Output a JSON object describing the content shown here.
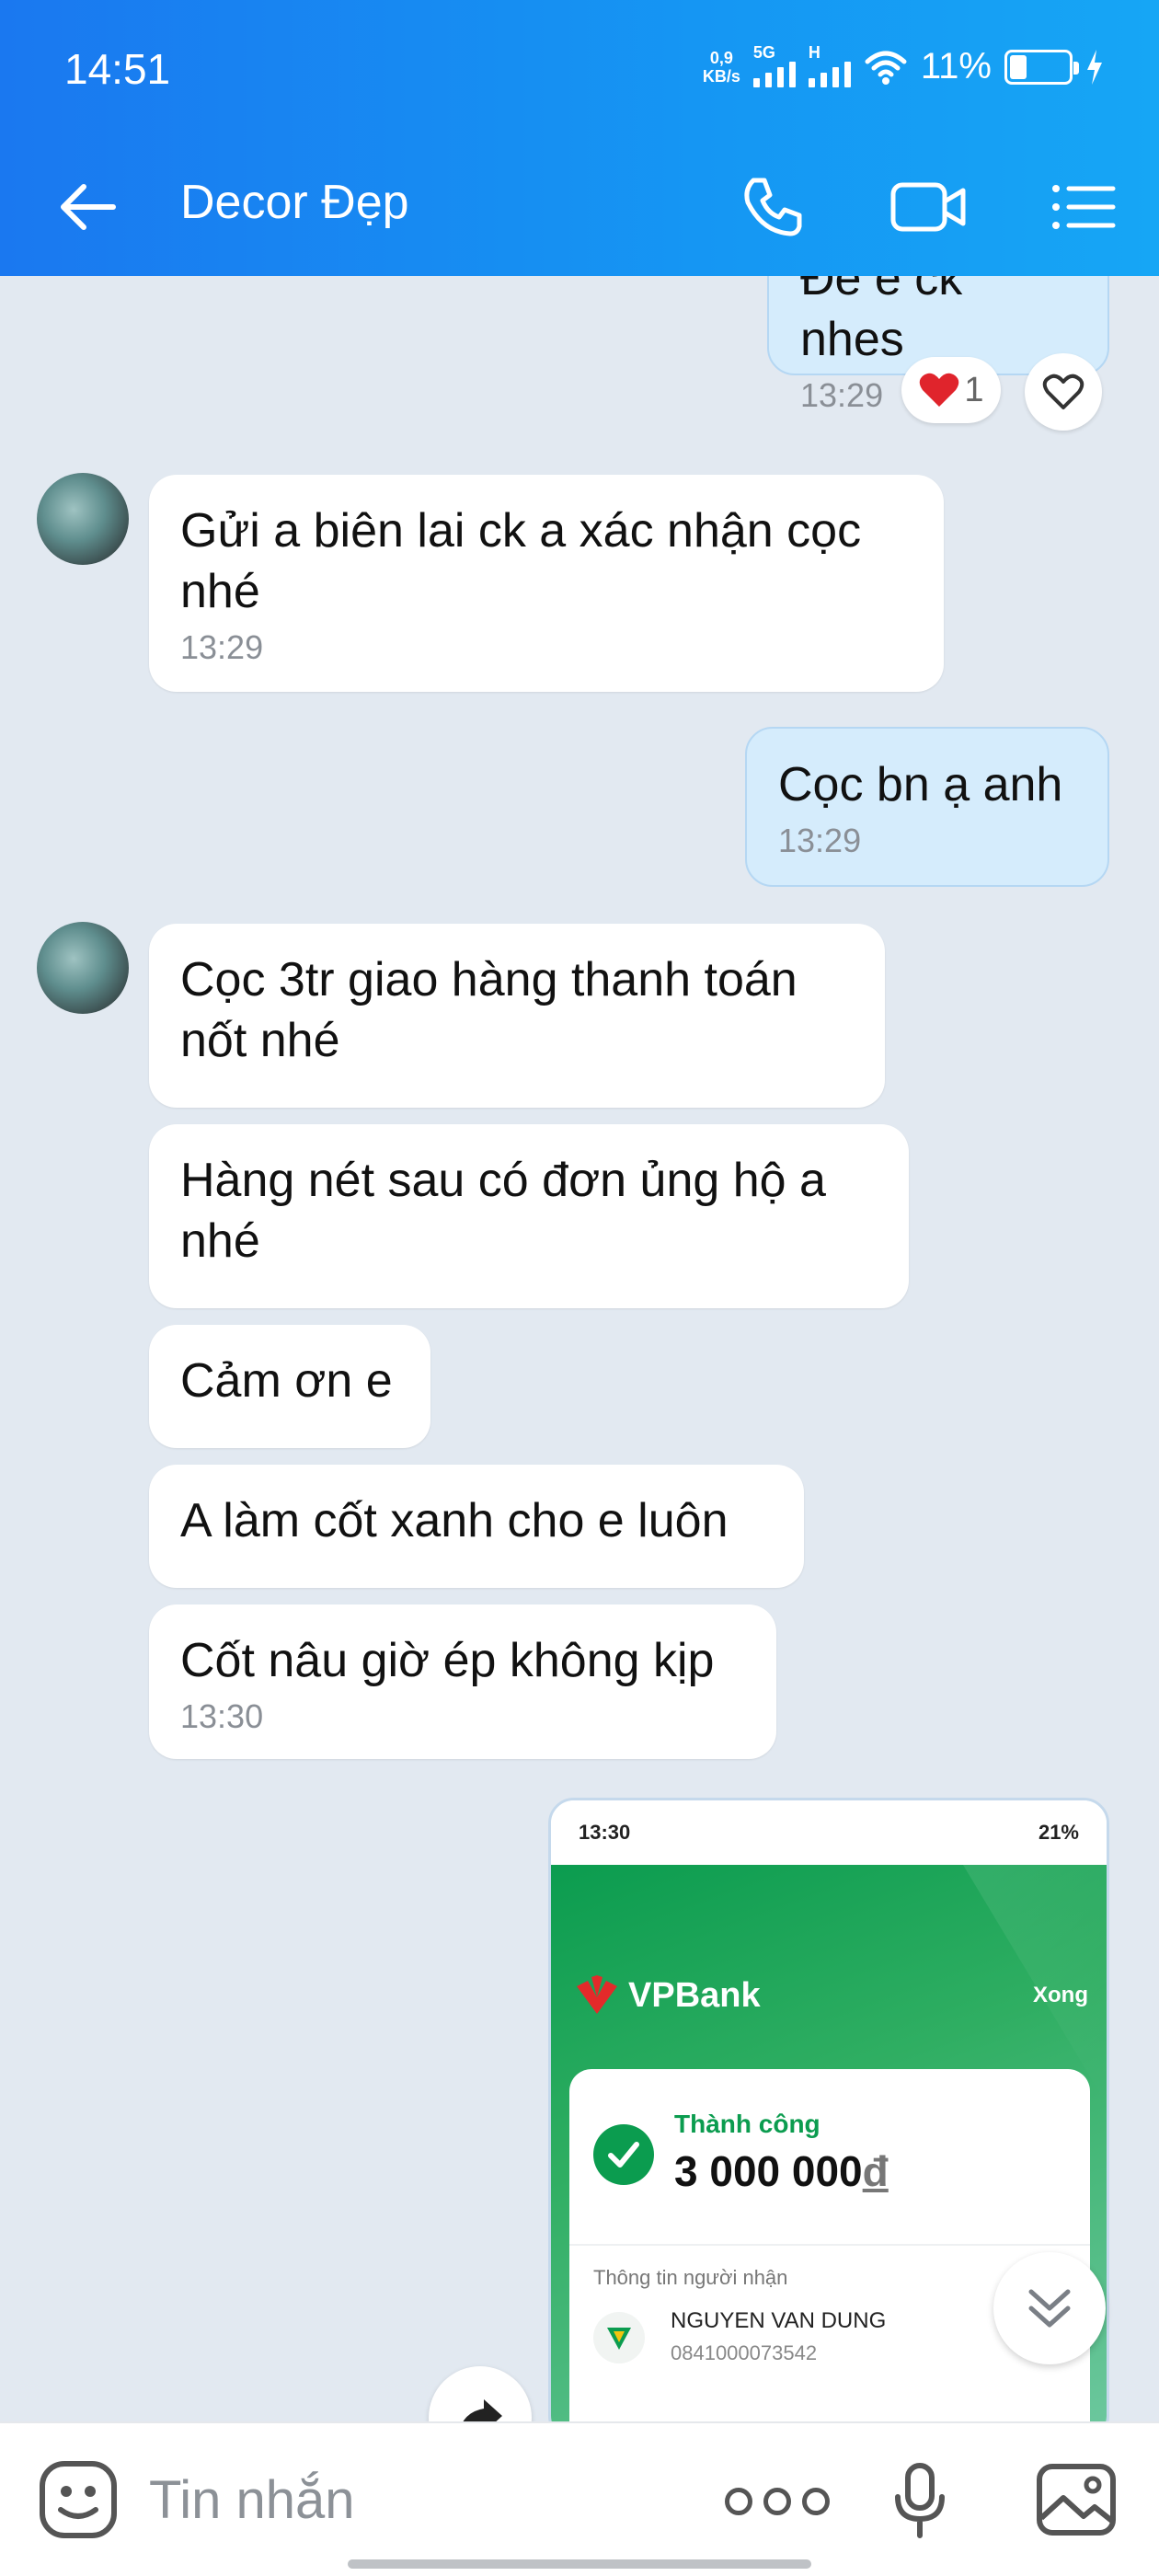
{
  "status_bar": {
    "time": "14:51",
    "net_speed_value": "0,9",
    "net_speed_unit": "KB/s",
    "sim1_label": "5G",
    "sim2_label": "H",
    "battery": "11%"
  },
  "header": {
    "title": "Decor Đẹp"
  },
  "messages": [
    {
      "dir": "out",
      "text": "Đe e ck nhes",
      "time": "13:29"
    },
    {
      "dir": "in",
      "text": "Gửi a biên lai ck a xác nhận cọc nhé",
      "time": "13:29"
    },
    {
      "dir": "out",
      "text": "Cọc bn ạ anh",
      "time": "13:29"
    },
    {
      "dir": "in",
      "text": "Cọc 3tr giao hàng thanh toán nốt nhé"
    },
    {
      "dir": "in",
      "text": "Hàng nét sau có đơn ủng hộ a nhé"
    },
    {
      "dir": "in",
      "text": "Cảm ơn e"
    },
    {
      "dir": "in",
      "text": "A làm cốt xanh cho e luôn"
    },
    {
      "dir": "in",
      "text": "Cốt nâu giờ ép không kịp",
      "time": "13:30"
    }
  ],
  "reaction": {
    "count": "1"
  },
  "image_message": {
    "status_time": "13:30",
    "status_right": "21%",
    "bank_name": "VPBank",
    "close_label": "Xong",
    "result_label": "Thành công",
    "amount": "3 000 000",
    "currency": "đ",
    "recipient_label": "Thông tin người nhận",
    "recipient_name": "NGUYEN VAN DUNG",
    "recipient_account": "0841000073542"
  },
  "input": {
    "placeholder": "Tin nhắn"
  },
  "colors": {
    "header": "#1a78f0",
    "incoming_bubble": "#ffffff",
    "outgoing_bubble": "#d5ecfc",
    "background": "#e2e9f1",
    "vpbank_green": "#0b9c4f"
  }
}
